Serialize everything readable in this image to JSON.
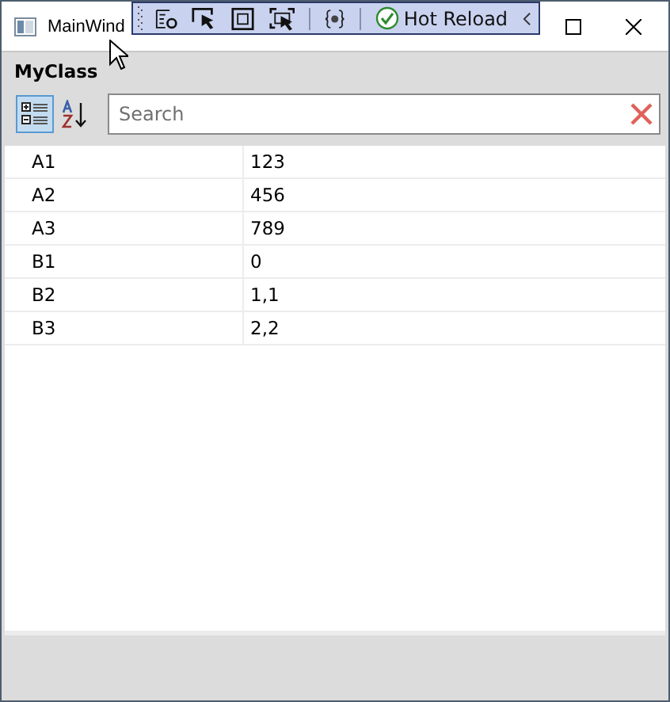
{
  "window": {
    "title": "MainWind"
  },
  "debug_toolbar": {
    "label": "Hot Reload"
  },
  "object_name": "MyClass",
  "view_buttons": [
    {
      "kind": "categorized",
      "selected": true
    },
    {
      "kind": "alphabetical",
      "selected": false
    }
  ],
  "search": {
    "placeholder": "Search"
  },
  "properties": [
    {
      "name": "A1",
      "value": "123"
    },
    {
      "name": "A2",
      "value": "456"
    },
    {
      "name": "A3",
      "value": "789"
    },
    {
      "name": "B1",
      "value": "0"
    },
    {
      "name": "B2",
      "value": "1,1"
    },
    {
      "name": "B3",
      "value": "2,2"
    }
  ]
}
